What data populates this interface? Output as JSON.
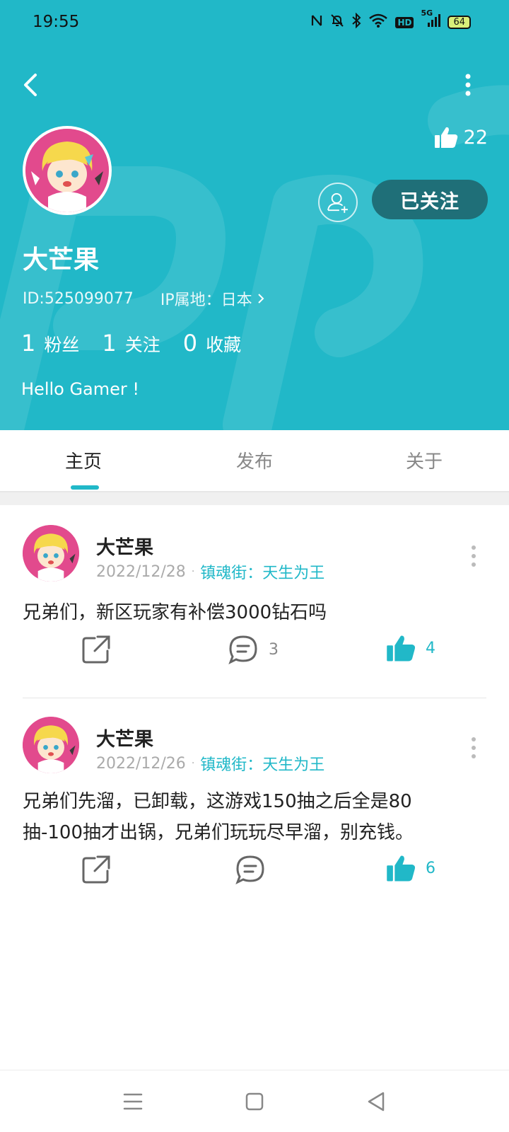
{
  "status_bar": {
    "time": "19:55",
    "hd": "HD",
    "network": "5G",
    "battery": "64"
  },
  "profile": {
    "like_count": "22",
    "follow_label": "已关注",
    "name": "大芒果",
    "id_text": "ID:525099077",
    "ip_text": "IP属地：日本",
    "stats": [
      {
        "num": "1",
        "label": "粉丝"
      },
      {
        "num": "1",
        "label": "关注"
      },
      {
        "num": "0",
        "label": "收藏"
      }
    ],
    "bio": "Hello Gamer !"
  },
  "tabs": [
    {
      "label": "主页"
    },
    {
      "label": "发布"
    },
    {
      "label": "关于"
    }
  ],
  "posts": [
    {
      "author": "大芒果",
      "date": "2022/12/28",
      "game": "镇魂街：天生为王",
      "text": "兄弟们，新区玩家有补偿3000钻石吗",
      "comments": "3",
      "likes": "4"
    },
    {
      "author": "大芒果",
      "date": "2022/12/26",
      "game": "镇魂街：天生为王",
      "text_lines": [
        "兄弟们先溜，已卸载，这游戏150抽之后全是80",
        "抽-100抽才出锅，兄弟们玩玩尽早溜，别充钱。"
      ],
      "comments": "",
      "likes": "6"
    }
  ],
  "colors": {
    "accent": "#21b8c8",
    "follow_button": "#1f6f78",
    "avatar_bg": "#e24a8d"
  }
}
